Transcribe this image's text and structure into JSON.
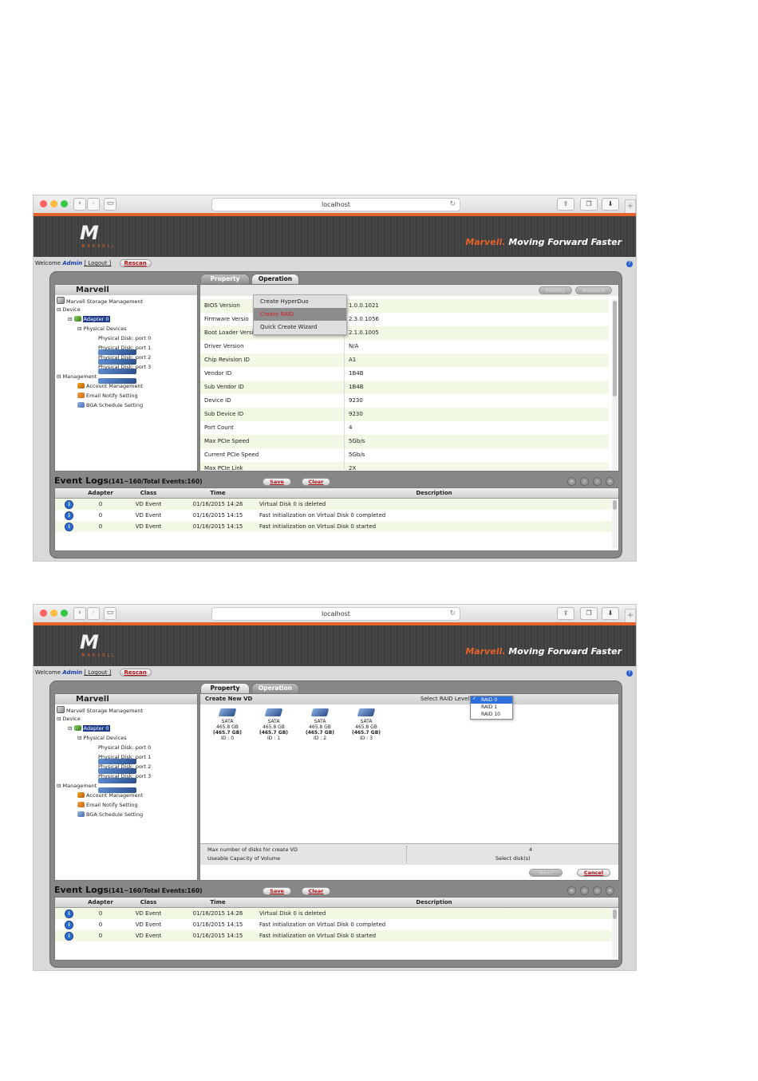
{
  "common": {
    "url": "localhost",
    "slogan_brand": "Marvell.",
    "slogan_text": " Moving Forward Faster",
    "logo_mark": "M",
    "logo_word": "MARVELL",
    "welcome": "Welcome",
    "user": "Admin",
    "logout": "[ Logout ]",
    "rescan": "Rescan",
    "panel_title": "Marvell",
    "tab_property": "Property",
    "tab_operation": "Operation",
    "tree": {
      "root": "Marvell Storage Management",
      "device": "Device",
      "adapter": "Adapter 0",
      "physical_devices": "Physical Devices",
      "disks": [
        "Physical Disk: port 0",
        "Physical Disk: port 1",
        "Physical Disk: port 2",
        "Physical Disk: port 3"
      ],
      "management": "Management",
      "account": "Account Management",
      "email": "Email Notify Setting",
      "bga": "BGA Schedule Setting"
    },
    "events": {
      "title": "Event Logs",
      "range": "(141~160/Total Events:160)",
      "save": "Save",
      "clear": "Clear",
      "columns": [
        "Adapter",
        "Class",
        "Time",
        "Description"
      ],
      "rows": [
        {
          "adapter": "0",
          "class": "VD Event",
          "time": "01/16/2015 14:26",
          "desc": "Virtual Disk 0 is deleted"
        },
        {
          "adapter": "0",
          "class": "VD Event",
          "time": "01/16/2015 14:15",
          "desc": "Fast initialization on Virtual Disk 0 completed"
        },
        {
          "adapter": "0",
          "class": "VD Event",
          "time": "01/16/2015 14:15",
          "desc": "Fast initialization on Virtual Disk 0 started"
        }
      ]
    }
  },
  "shot1": {
    "modify": "Modify",
    "restore": "Restore",
    "menu": [
      "Create HyperDuo",
      "Create RAID",
      "Quick Create Wizard"
    ],
    "properties": [
      {
        "k": "BIOS Version",
        "v": "1.0.0.1021"
      },
      {
        "k": "Firmware Versio",
        "v": "2.3.0.1056"
      },
      {
        "k": "Boot Loader Version",
        "v": "2.1.0.1005"
      },
      {
        "k": "Driver Version",
        "v": "N/A"
      },
      {
        "k": "Chip Revision ID",
        "v": "A1"
      },
      {
        "k": "Vendor ID",
        "v": "1B4B"
      },
      {
        "k": "Sub Vendor ID",
        "v": "1B4B"
      },
      {
        "k": "Device ID",
        "v": "9230"
      },
      {
        "k": "Sub Device ID",
        "v": "9230"
      },
      {
        "k": "Port Count",
        "v": "4"
      },
      {
        "k": "Max PCIe Speed",
        "v": "5Gb/s"
      },
      {
        "k": "Current PCIe Speed",
        "v": "5Gb/s"
      },
      {
        "k": "Max PCIe Link",
        "v": "2X"
      }
    ]
  },
  "shot2": {
    "create_vd": "Create New VD",
    "select_raid": "Select RAID Level",
    "raid_options": [
      "RAID 0",
      "RAID 1",
      "RAID 10"
    ],
    "disks": [
      {
        "type": "SATA",
        "size": "465.8 GB",
        "cap": "(465.7 GB)",
        "id": "ID : 0"
      },
      {
        "type": "SATA",
        "size": "465.8 GB",
        "cap": "(465.7 GB)",
        "id": "ID : 1"
      },
      {
        "type": "SATA",
        "size": "465.8 GB",
        "cap": "(465.7 GB)",
        "id": "ID : 2"
      },
      {
        "type": "SATA",
        "size": "465.8 GB",
        "cap": "(465.7 GB)",
        "id": "ID : 3"
      }
    ],
    "max_disks_label": "Max number of disks for create VD",
    "max_disks_value": "4",
    "capacity_label": "Useable Capacity of Volume",
    "capacity_value": "Select disk(s)",
    "next": "Next",
    "cancel": "Cancel"
  }
}
